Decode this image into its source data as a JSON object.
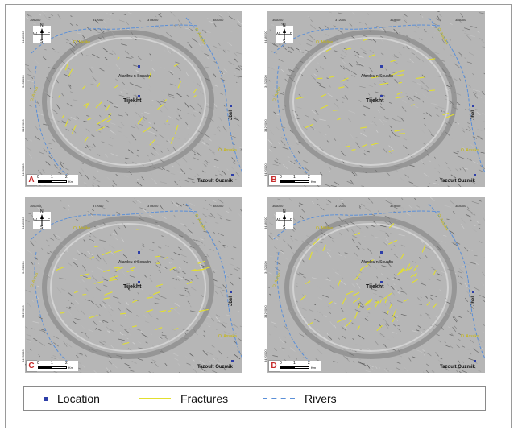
{
  "coords": {
    "top": [
      "366000",
      "372000",
      "378000",
      "384000"
    ],
    "left": [
      "3438000",
      "3432000",
      "3426000",
      "3420000"
    ]
  },
  "places": {
    "afardou": "Afardou n Souafin",
    "tijekht": "Tijekht",
    "tazoult": "Tazoult Ouzmik",
    "jbel": "Jbel"
  },
  "rivers": {
    "melike": "O. Melike",
    "assaka": "O. Assaka",
    "assaka_lower": "O. Assaka",
    "azrou": "O. Azrou"
  },
  "compass": {
    "n": "N",
    "s": "S",
    "e": "E",
    "w": "W"
  },
  "scale": {
    "n0": "0",
    "n1": "1",
    "n2": "2",
    "unit": "Km"
  },
  "panels": [
    {
      "letter": "A",
      "variant": "fracture-set-A"
    },
    {
      "letter": "B",
      "variant": "fracture-set-B"
    },
    {
      "letter": "C",
      "variant": "fracture-set-C"
    },
    {
      "letter": "D",
      "variant": "fracture-set-D"
    }
  ],
  "legend": {
    "location": "Location",
    "fractures": "Fractures",
    "rivers": "Rivers"
  },
  "colors": {
    "fracture": "#e2df2e",
    "river": "#5a8fd8",
    "location": "#2d3ea8",
    "panel_letter": "#c62a2a"
  }
}
